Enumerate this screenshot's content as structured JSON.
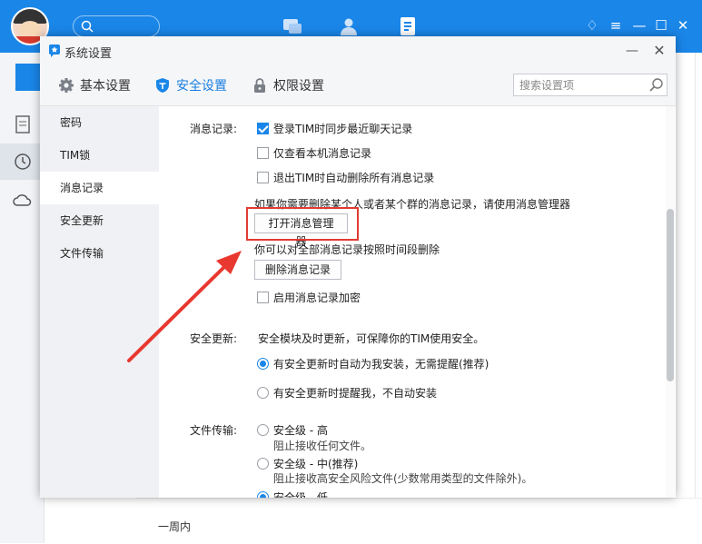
{
  "colors": {
    "accent": "#1a86e8",
    "highlight": "#e23b33",
    "annotation_arrow": "#e8382f"
  },
  "background_window": {
    "list_item_label": "一周内",
    "icons": [
      "avatar-icon",
      "search-icon",
      "chat-icon",
      "contacts-icon",
      "docs-icon",
      "skin-icon",
      "menu-icon",
      "minimize-icon",
      "maximize-icon",
      "close-icon"
    ]
  },
  "dialog": {
    "title": "系统设置",
    "title_icon": "tim-star-icon",
    "minimize_label": "—",
    "close_label": "✕",
    "tabs": [
      {
        "label": "基本设置",
        "icon": "gear-icon",
        "active": false
      },
      {
        "label": "安全设置",
        "icon": "shield-icon",
        "active": true
      },
      {
        "label": "权限设置",
        "icon": "lock-icon",
        "active": false
      }
    ],
    "search": {
      "placeholder": "搜索设置项",
      "value": ""
    },
    "nav": [
      {
        "label": "密码",
        "active": false
      },
      {
        "label": "TIM锁",
        "active": false
      },
      {
        "label": "消息记录",
        "active": true
      },
      {
        "label": "安全更新",
        "active": false
      },
      {
        "label": "文件传输",
        "active": false
      }
    ],
    "message_records": {
      "label": "消息记录:",
      "options": [
        {
          "label": "登录TIM时同步最近聊天记录",
          "checked": true
        },
        {
          "label": "仅查看本机消息记录",
          "checked": false
        },
        {
          "label": "退出TIM时自动删除所有消息记录",
          "checked": false
        }
      ],
      "manager_hint": "如果你需要删除某个人或者某个群的消息记录，请使用消息管理器",
      "open_manager_button": "打开消息管理器",
      "delete_hint": "你可以对全部消息记录按照时间段删除",
      "delete_button": "删除消息记录",
      "encrypt_option": {
        "label": "启用消息记录加密",
        "checked": false
      }
    },
    "security_update": {
      "label": "安全更新:",
      "description": "安全模块及时更新，可保障你的TIM使用安全。",
      "options": [
        {
          "label": "有安全更新时自动为我安装，无需提醒(推荐)",
          "checked": true
        },
        {
          "label": "有安全更新时提醒我，不自动安装",
          "checked": false
        }
      ]
    },
    "file_transfer": {
      "label": "文件传输:",
      "options": [
        {
          "label": "安全级 - 高",
          "desc": "阻止接收任何文件。",
          "checked": false
        },
        {
          "label": "安全级 - 中(推荐)",
          "desc": "阻止接收高安全风险文件(少数常用类型的文件除外)。",
          "checked": false
        },
        {
          "label": "安全级 - 低",
          "desc": "",
          "checked": true
        }
      ]
    }
  }
}
